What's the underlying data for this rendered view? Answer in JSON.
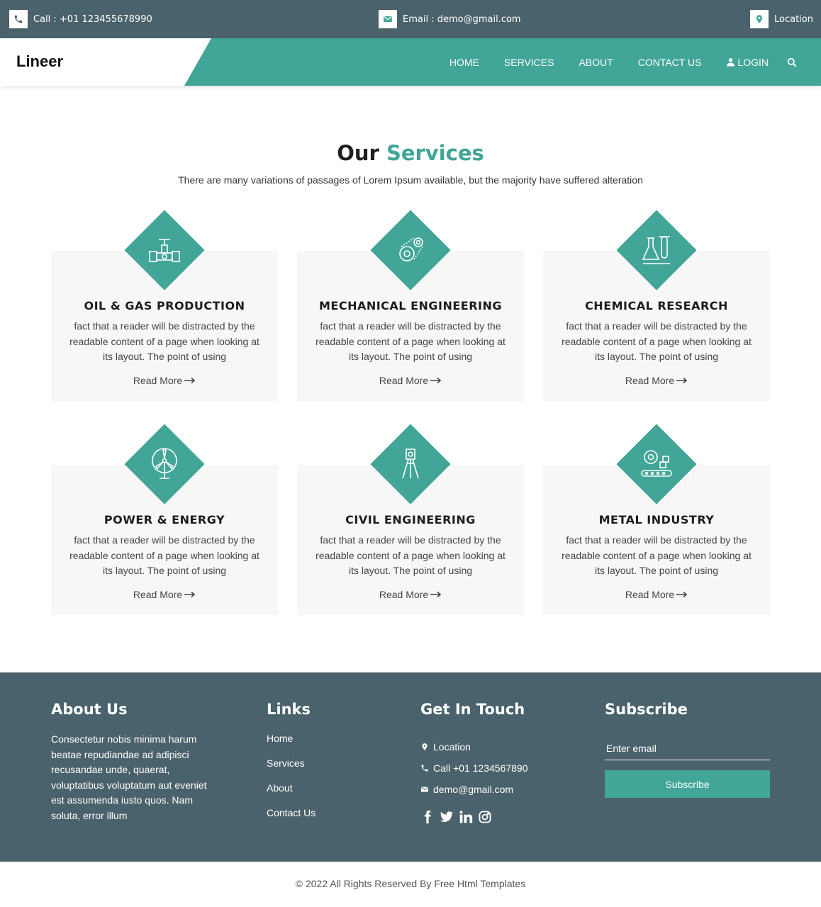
{
  "topbar": {
    "call": "Call : +01 123455678990",
    "email": "Email : demo@gmail.com",
    "location": "Location"
  },
  "nav": {
    "brand": "Lineer",
    "items": [
      "HOME",
      "SERVICES",
      "ABOUT",
      "CONTACT US",
      "LOGIN"
    ]
  },
  "services": {
    "title_part1": "Our",
    "title_part2": "Services",
    "subtitle": "There are many variations of passages of Lorem Ipsum available, but the majority have suffered alteration",
    "cards": [
      {
        "title": "OIL & GAS PRODUCTION",
        "icon": "valve-pipe-icon",
        "text": "fact that a reader will be distracted by the readable content of a page when looking at its layout. The point of using",
        "link": "Read More"
      },
      {
        "title": "MECHANICAL ENGINEERING",
        "icon": "gears-chain-icon",
        "text": "fact that a reader will be distracted by the readable content of a page when looking at its layout. The point of using",
        "link": "Read More"
      },
      {
        "title": "CHEMICAL RESEARCH",
        "icon": "flask-tube-icon",
        "text": "fact that a reader will be distracted by the readable content of a page when looking at its layout. The point of using",
        "link": "Read More"
      },
      {
        "title": "POWER & ENERGY",
        "icon": "wind-turbine-icon",
        "text": "fact that a reader will be distracted by the readable content of a page when looking at its layout. The point of using",
        "link": "Read More"
      },
      {
        "title": "CIVIL ENGINEERING",
        "icon": "surveyor-tripod-icon",
        "text": "fact that a reader will be distracted by the readable content of a page when looking at its layout. The point of using",
        "link": "Read More"
      },
      {
        "title": "METAL INDUSTRY",
        "icon": "conveyor-gear-icon",
        "text": "fact that a reader will be distracted by the readable content of a page when looking at its layout. The point of using",
        "link": "Read More"
      }
    ]
  },
  "footer": {
    "about_title": "About Us",
    "about_text": "Consectetur nobis minima harum beatae repudiandae ad adipisci recusandae unde, quaerat, voluptatibus voluptatum aut eveniet est assumenda iusto quos. Nam soluta, error illum",
    "links_title": "Links",
    "links": [
      "Home",
      "Services",
      "About",
      "Contact Us"
    ],
    "contact_title": "Get In Touch",
    "contact_location": "Location",
    "contact_call": "Call +01 1234567890",
    "contact_email": "demo@gmail.com",
    "subscribe_title": "Subscribe",
    "subscribe_placeholder": "Enter email",
    "subscribe_button": "Subscribe"
  },
  "copyright": "© 2022 All Rights Reserved By Free Html Templates",
  "colors": {
    "accent": "#41a597",
    "dark": "#4a626b",
    "card_bg": "#f7f7f7"
  }
}
